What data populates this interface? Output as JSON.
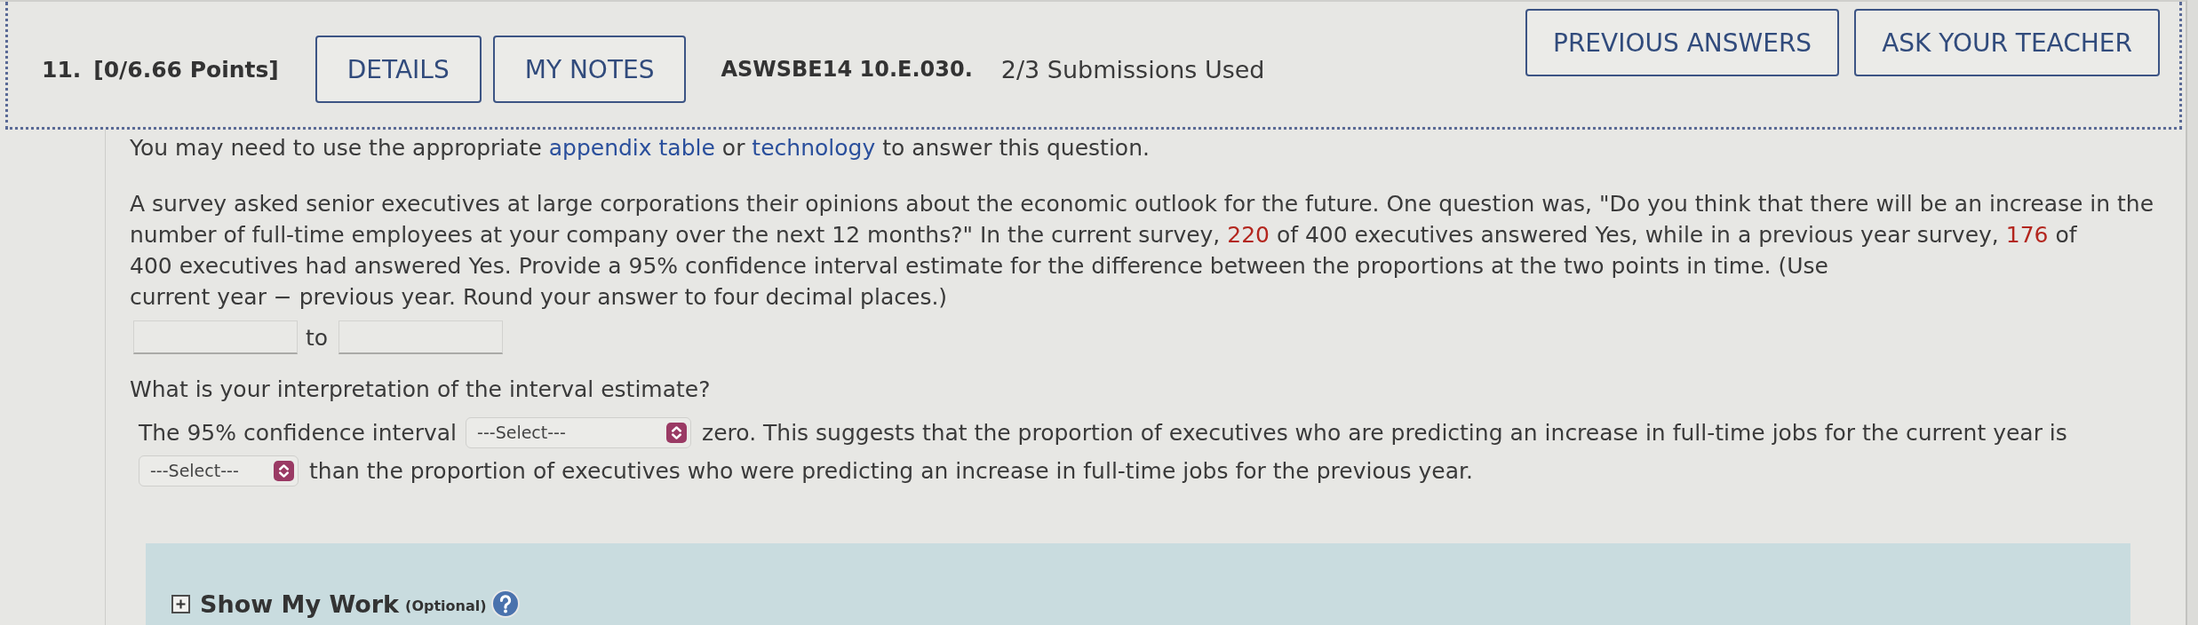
{
  "header": {
    "number": "11.",
    "points": "[0/6.66 Points]",
    "buttons": [
      {
        "label": "DETAILS"
      },
      {
        "label": "MY NOTES"
      }
    ],
    "code": "ASWSBE14 10.E.030.",
    "submissions": "2/3 Submissions Used",
    "actions": [
      {
        "label": "PREVIOUS ANSWERS"
      },
      {
        "label": "ASK YOUR TEACHER"
      }
    ]
  },
  "instruction": [
    {
      "kind": "text",
      "text": "You may need to use the appropriate "
    },
    {
      "kind": "link",
      "text": "appendix table"
    },
    {
      "kind": "text",
      "text": " or "
    },
    {
      "kind": "link",
      "text": "technology"
    },
    {
      "kind": "text",
      "text": " to answer this question."
    }
  ],
  "problem": [
    {
      "kind": "text",
      "text": "A survey asked senior executives at large corporations their opinions about the economic outlook for the future. One question was, \"Do you think that there will be an increase in the number of full-time employees at your company over the next 12 months?\" In the current survey, "
    },
    {
      "kind": "value",
      "text": "220"
    },
    {
      "kind": "text",
      "text": " of 400 executives answered Yes, while in a previous year survey, "
    },
    {
      "kind": "value",
      "text": "176"
    },
    {
      "kind": "text",
      "text": " of 400 executives had answered Yes. Provide a 95% confidence interval estimate for the difference between the proportions at the two points in time. (Use current year − previous year. Round your answer to four decimal places.)"
    }
  ],
  "interval": {
    "separator": "to",
    "fields": [
      {
        "kind": "input"
      },
      {
        "kind": "input"
      }
    ]
  },
  "interpretation": {
    "question": "What is your interpretation of the interval estimate?",
    "lines": [
      [
        {
          "kind": "text",
          "text": "The 95% confidence interval"
        },
        {
          "kind": "select",
          "value": "---Select---"
        },
        {
          "kind": "text",
          "text": "zero. This suggests that the proportion of executives who are predicting an increase in full-time jobs for the current year is"
        }
      ],
      [
        {
          "kind": "select",
          "value": "---Select---"
        },
        {
          "kind": "text",
          "text": "than the proportion of executives who were predicting an increase in full-time jobs for the previous year."
        }
      ]
    ]
  },
  "show_my_work": {
    "expanded": false,
    "title": "Show My Work",
    "note": "(Optional)"
  }
}
